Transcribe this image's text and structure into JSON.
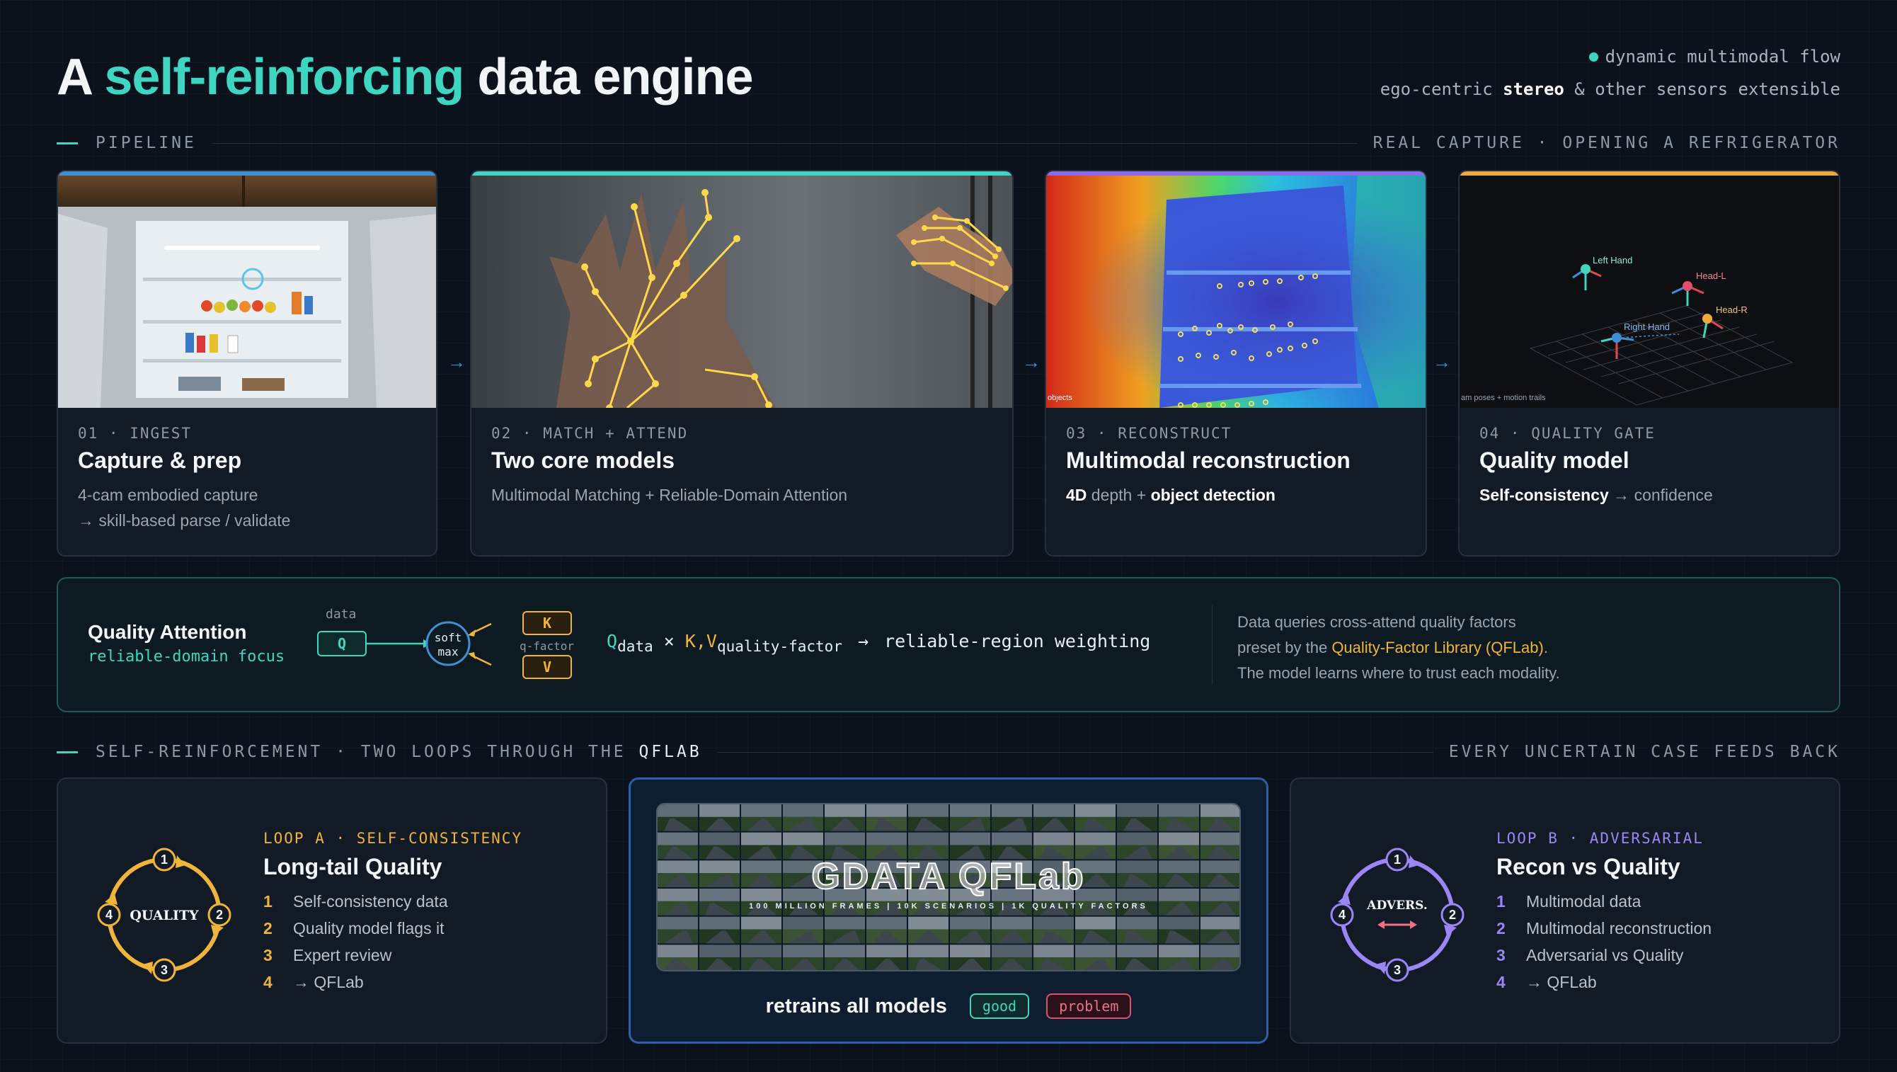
{
  "header": {
    "title_prefix": "A ",
    "title_highlight": "self-reinforcing",
    "title_suffix": " data engine",
    "status": "dynamic multimodal flow",
    "subtitle_prefix": "ego-centric ",
    "subtitle_bold": "stereo",
    "subtitle_suffix": " & other sensors extensible"
  },
  "pipeline_section": {
    "label": "PIPELINE",
    "right": "REAL CAPTURE · OPENING A REFRIGERATOR"
  },
  "cards": [
    {
      "step": "01 · INGEST",
      "title": "Capture & prep",
      "desc1": "4-cam embodied capture",
      "desc2": "→ skill-based parse / validate",
      "accent": "#3f8fd6"
    },
    {
      "step": "02 · MATCH + ATTEND",
      "title": "Two core models",
      "desc1": "Multimodal Matching + Reliable-Domain Attention",
      "accent": "#3fd6c1"
    },
    {
      "step": "03 · RECONSTRUCT",
      "title": "Multimodal reconstruction",
      "desc_b1": "4D",
      "desc_m1": " depth + ",
      "desc_b2": "object detection",
      "overlay": "objects",
      "accent": "#8b6cf0"
    },
    {
      "step": "04 · QUALITY GATE",
      "title": "Quality model",
      "desc_b1": "Self-consistency",
      "desc_m1": " → confidence",
      "overlay": "am poses + motion trails",
      "accent": "#f0a83a"
    }
  ],
  "pose_labels": [
    "Left Hand",
    "Head-L",
    "Head-R",
    "Right Hand"
  ],
  "quality_attention": {
    "title": "Quality Attention",
    "subtitle": "reliable-domain focus",
    "data_label": "data",
    "q": "Q",
    "softmax1": "soft",
    "softmax2": "max",
    "k": "K",
    "v": "V",
    "qfactor": "q-factor",
    "f_q": "Q",
    "f_qsub": "data",
    "f_times": " × ",
    "f_kv": "K,V",
    "f_kvsub": "quality-factor",
    "f_arrow": "→",
    "f_result": "reliable-region weighting",
    "desc1": "Data queries cross-attend quality factors",
    "desc2_prefix": "preset by the ",
    "desc2_hl": "Quality-Factor Library (QFLab)",
    "desc2_suffix": ".",
    "desc3": "The model learns where to trust each modality."
  },
  "self_section": {
    "label": "SELF-REINFORCEMENT · TWO LOOPS THROUGH THE ",
    "label_bold": "QFLAB",
    "right": "EVERY UNCERTAIN CASE FEEDS BACK"
  },
  "loop_a": {
    "sub": "LOOP A · SELF-CONSISTENCY",
    "title": "Long-tail Quality",
    "center": "QUALITY",
    "nums": [
      "1",
      "2",
      "3",
      "4"
    ],
    "items": [
      "Self-consistency data",
      "Quality model flags it",
      "Expert review",
      "→ QFLab"
    ],
    "color": "#f0b43a"
  },
  "qflab": {
    "title": "GDATA QFLab",
    "stats": "100 MILLION FRAMES | 10K SCENARIOS | 1K QUALITY FACTORS",
    "caption": "retrains all models",
    "good": "good",
    "problem": "problem"
  },
  "loop_b": {
    "sub": "LOOP B · ADVERSARIAL",
    "title": "Recon vs Quality",
    "center": "ADVERS.",
    "nums": [
      "1",
      "2",
      "3",
      "4"
    ],
    "items": [
      "Multimodal data",
      "Multimodal reconstruction",
      "Adversarial vs Quality",
      "→ QFLab"
    ],
    "color": "#9b86f5"
  }
}
